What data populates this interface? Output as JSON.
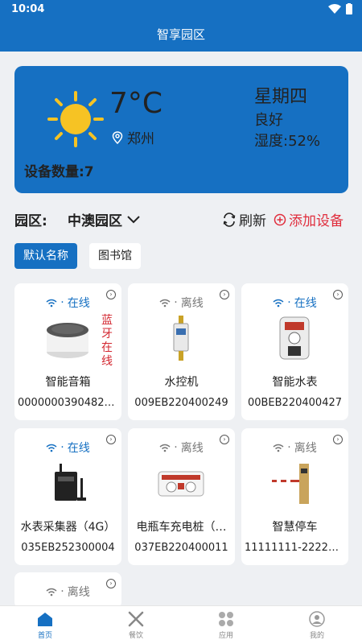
{
  "status_bar": {
    "time": "10:04"
  },
  "header": {
    "title": "智享园区"
  },
  "weather": {
    "temperature": "7°C",
    "city": "郑州",
    "weekday": "星期四",
    "air_quality": "良好",
    "humidity": "湿度:52%",
    "device_count": "设备数量:7"
  },
  "filter": {
    "park_label": "园区:",
    "park_value": "中澳园区",
    "refresh_label": "刷新",
    "add_label": "添加设备"
  },
  "tabs": [
    {
      "label": "默认名称",
      "active": true
    },
    {
      "label": "图书馆",
      "active": false
    }
  ],
  "devices": [
    {
      "status": "在线",
      "name": "智能音箱",
      "code": "00000003904820…",
      "icon": "speaker-icon",
      "online": true,
      "extra": "蓝牙在线"
    },
    {
      "status": "离线",
      "name": "水控机",
      "code": "009EB220400249",
      "icon": "water-controller-icon",
      "online": false
    },
    {
      "status": "在线",
      "name": "智能水表",
      "code": "00BEB220400427",
      "icon": "water-meter-icon",
      "online": true
    },
    {
      "status": "在线",
      "name": "水表采集器（4G）",
      "code": "035EB252300004",
      "icon": "data-collector-icon",
      "online": true
    },
    {
      "status": "离线",
      "name": "电瓶车充电桩（…",
      "code": "037EB220400011",
      "icon": "charging-pile-icon",
      "online": false
    },
    {
      "status": "离线",
      "name": "智慧停车",
      "code": "11111111-22222…",
      "icon": "parking-barrier-icon",
      "online": false
    },
    {
      "status": "离线",
      "name": "",
      "code": "",
      "icon": "",
      "online": false
    }
  ],
  "status_separator": "·",
  "bottom_nav": [
    {
      "label": "首页",
      "icon": "home-icon",
      "active": true
    },
    {
      "label": "餐饮",
      "icon": "dining-icon",
      "active": false
    },
    {
      "label": "应用",
      "icon": "apps-icon",
      "active": false
    },
    {
      "label": "我的",
      "icon": "profile-icon",
      "active": false
    }
  ],
  "colors": {
    "primary": "#1670c2",
    "accent_red": "#e02d3c",
    "background": "#eef0f3"
  }
}
